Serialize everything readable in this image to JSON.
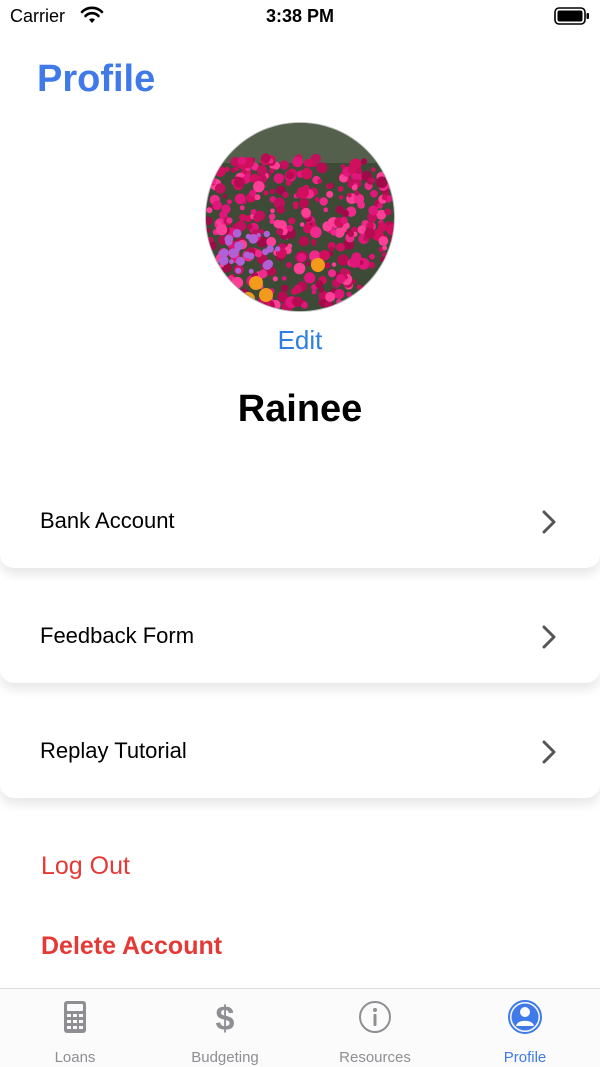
{
  "status_bar": {
    "carrier": "Carrier",
    "time": "3:38 PM"
  },
  "header": {
    "title": "Profile"
  },
  "profile": {
    "edit_label": "Edit",
    "name": "Rainee"
  },
  "menu": {
    "items": [
      {
        "label": "Bank Account"
      },
      {
        "label": "Feedback Form"
      },
      {
        "label": "Replay Tutorial"
      }
    ]
  },
  "actions": {
    "logout_label": "Log Out",
    "delete_label": "Delete Account"
  },
  "tab_bar": {
    "tabs": [
      {
        "label": "Loans",
        "icon": "calculator-icon"
      },
      {
        "label": "Budgeting",
        "icon": "dollar-icon"
      },
      {
        "label": "Resources",
        "icon": "info-icon"
      },
      {
        "label": "Profile",
        "icon": "person-icon",
        "active": true
      }
    ]
  },
  "colors": {
    "accent": "#3f7ae8",
    "link": "#2f7fe0",
    "danger": "#e53935",
    "inactive": "#8e8e93"
  }
}
